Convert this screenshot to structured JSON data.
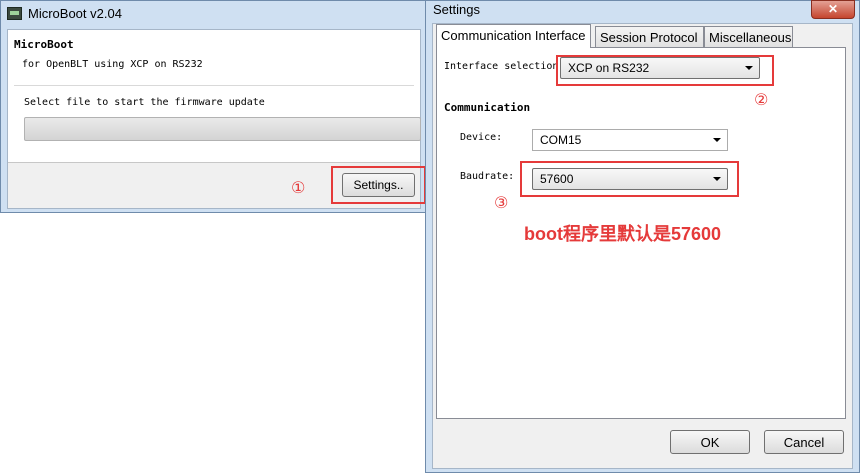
{
  "main_window": {
    "title": "MicroBoot v2.04",
    "heading": "MicroBoot",
    "subtitle": "for OpenBLT using XCP on RS232",
    "select_file_text": "Select file to start the firmware update",
    "progress_percent": 0,
    "settings_button_label": "Settings.."
  },
  "settings_dialog": {
    "title": "Settings",
    "close_label": "✕",
    "tabs": [
      {
        "label": "Communication Interface",
        "active": true
      },
      {
        "label": "Session Protocol",
        "active": false
      },
      {
        "label": "Miscellaneous",
        "active": false
      }
    ],
    "interface_selection_label": "Interface selection",
    "interface_selection_value": "XCP on RS232",
    "communication_heading": "Communication",
    "device_label": "Device:",
    "device_value": "COM15",
    "baudrate_label": "Baudrate:",
    "baudrate_value": "57600",
    "ok_label": "OK",
    "cancel_label": "Cancel"
  },
  "annotations": {
    "marker_1": "①",
    "marker_2": "②",
    "marker_3": "③",
    "note": "boot程序里默认是57600",
    "highlight_color": "#e53a3a"
  }
}
